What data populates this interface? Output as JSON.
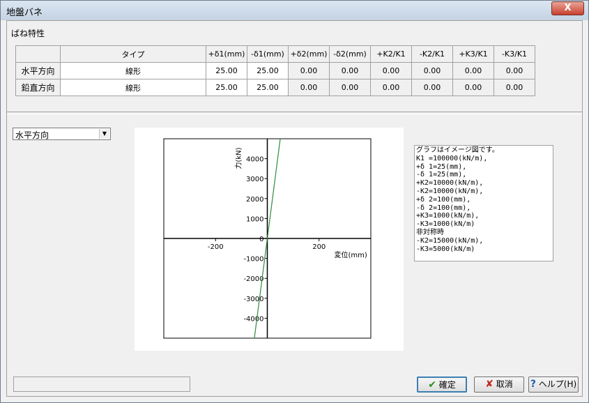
{
  "window": {
    "title": "地盤バネ",
    "close_label": "X"
  },
  "section_label": "ばね特性",
  "table": {
    "headers": [
      "タイプ",
      "+δ1(mm)",
      "-δ1(mm)",
      "+δ2(mm)",
      "-δ2(mm)",
      "+K2/K1",
      "-K2/K1",
      "+K3/K1",
      "-K3/K1"
    ],
    "rows": [
      {
        "label": "水平方向",
        "cells": [
          "線形",
          "25.00",
          "25.00",
          "0.00",
          "0.00",
          "0.00",
          "0.00",
          "0.00",
          "0.00"
        ]
      },
      {
        "label": "鉛直方向",
        "cells": [
          "線形",
          "25.00",
          "25.00",
          "0.00",
          "0.00",
          "0.00",
          "0.00",
          "0.00",
          "0.00"
        ]
      }
    ]
  },
  "direction_select": {
    "value": "水平方向"
  },
  "chart_data": {
    "type": "line",
    "xlabel": "変位(mm)",
    "ylabel": "力(kN)",
    "xlim": [
      -400,
      400
    ],
    "ylim": [
      -5000,
      5000
    ],
    "xticks": [
      -200,
      200
    ],
    "yticks": [
      4000,
      3000,
      2000,
      1000,
      0,
      -1000,
      -2000,
      -3000,
      -4000
    ],
    "series": [
      {
        "x": [
          -50,
          50
        ],
        "y": [
          -5000,
          5000
        ]
      }
    ],
    "line_color": "#2e8b3e"
  },
  "note_lines": [
    "グラフはイメージ図です。",
    " K1 =100000(kN/m),",
    " +δ 1=25(mm),",
    " -δ 1=25(mm),",
    " +K2=10000(kN/m),",
    " -K2=10000(kN/m),",
    " +δ 2=100(mm),",
    " -δ 2=100(mm),",
    " +K3=1000(kN/m),",
    " -K3=1000(kN/m)",
    "非対称時",
    " -K2=15000(kN/m),",
    " -K3=5000(kN/m)"
  ],
  "buttons": {
    "ok": "確定",
    "cancel": "取消",
    "help": "ヘルプ(H)"
  }
}
